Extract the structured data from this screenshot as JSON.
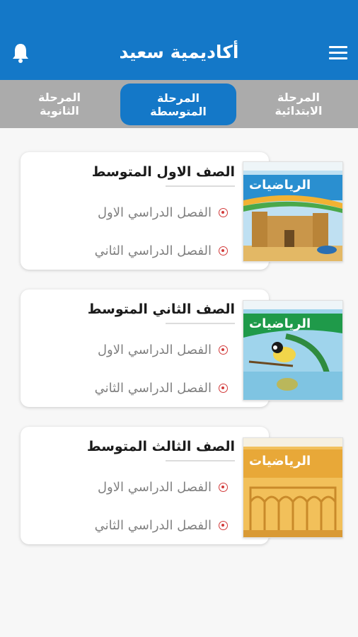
{
  "appbar": {
    "title": "أكاديمية سعيد",
    "menu_icon": "hamburger-menu-icon",
    "bell_icon": "bell-icon"
  },
  "tabs": [
    {
      "label": "المرحلة الابتدائية",
      "active": false
    },
    {
      "label": "المرحلة المتوسطة",
      "active": true
    },
    {
      "label": "المرحلة الثانوية",
      "active": false
    }
  ],
  "grades": [
    {
      "title": "الصف الاول المتوسط",
      "semesters": [
        "الفصل الدراسي الاول",
        "الفصل الدراسي الثاني"
      ],
      "cover_text": "الرياضيات"
    },
    {
      "title": "الصف الثاني المتوسط",
      "semesters": [
        "الفصل الدراسي الاول",
        "الفصل الدراسي الثاني"
      ],
      "cover_text": "الرياضيات"
    },
    {
      "title": "الصف الثالث المتوسط",
      "semesters": [
        "الفصل الدراسي الاول",
        "الفصل الدراسي الثاني"
      ],
      "cover_text": "الرياضيات"
    }
  ],
  "colors": {
    "primary": "#1478c8",
    "tab_bar": "#ababab",
    "radio": "#d23b3b"
  }
}
